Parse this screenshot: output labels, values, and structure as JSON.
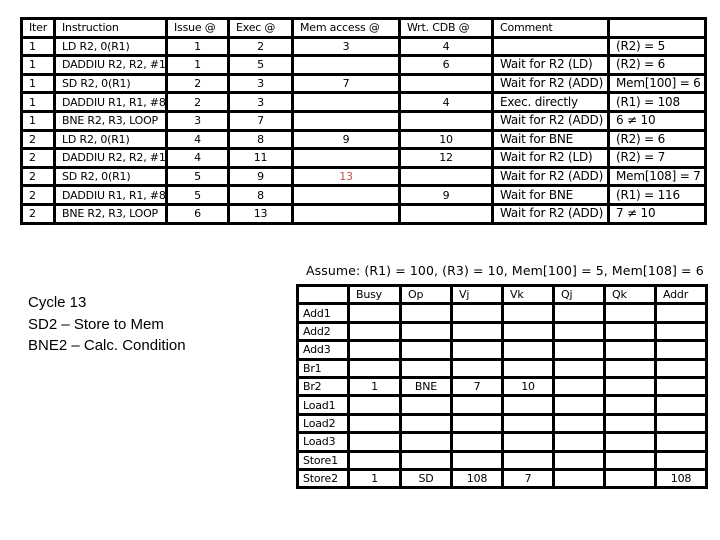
{
  "schedule": {
    "headers": [
      "Iter",
      "Instruction",
      "Issue @",
      "Exec @",
      "Mem access @",
      "Wrt. CDB @",
      "Comment",
      ""
    ],
    "rows": [
      {
        "iter": "1",
        "instruction": "LD R2, 0(R1)",
        "issue": "1",
        "exec": "2",
        "mem": "3",
        "cdb": "4",
        "comment": "",
        "result": "(R2) = 5"
      },
      {
        "iter": "1",
        "instruction": "DADDIU R2, R2, #1",
        "issue": "1",
        "exec": "5",
        "mem": "",
        "cdb": "6",
        "comment": "Wait for R2 (LD)",
        "result": "(R2) = 6"
      },
      {
        "iter": "1",
        "instruction": "SD R2, 0(R1)",
        "issue": "2",
        "exec": "3",
        "mem": "7",
        "cdb": "",
        "comment": "Wait for R2 (ADD)",
        "result": "Mem[100] = 6"
      },
      {
        "iter": "1",
        "instruction": "DADDIU R1, R1, #8",
        "issue": "2",
        "exec": "3",
        "mem": "",
        "cdb": "4",
        "comment": "Exec. directly",
        "result": "(R1) = 108"
      },
      {
        "iter": "1",
        "instruction": "BNE R2, R3, LOOP",
        "issue": "3",
        "exec": "7",
        "mem": "",
        "cdb": "",
        "comment": "Wait for R2 (ADD)",
        "result": "6 ≠ 10"
      },
      {
        "iter": "2",
        "instruction": "LD R2, 0(R1)",
        "issue": "4",
        "exec": "8",
        "mem": "9",
        "cdb": "10",
        "comment": "Wait for BNE",
        "result": "(R2) = 6"
      },
      {
        "iter": "2",
        "instruction": "DADDIU R2, R2, #1",
        "issue": "4",
        "exec": "11",
        "mem": "",
        "cdb": "12",
        "comment": "Wait for R2 (LD)",
        "result": "(R2) = 7"
      },
      {
        "iter": "2",
        "instruction": "SD R2, 0(R1)",
        "issue": "5",
        "exec": "9",
        "mem": "13",
        "cdb": "",
        "comment": "Wait for R2 (ADD)",
        "result": "Mem[108] = 7"
      },
      {
        "iter": "2",
        "instruction": "DADDIU R1, R1, #8",
        "issue": "5",
        "exec": "8",
        "mem": "",
        "cdb": "9",
        "comment": "Wait for BNE",
        "result": "(R1) = 116"
      },
      {
        "iter": "2",
        "instruction": "BNE R2, R3, LOOP",
        "issue": "6",
        "exec": "13",
        "mem": "",
        "cdb": "",
        "comment": "Wait for R2 (ADD)",
        "result": "7 ≠ 10"
      }
    ],
    "highlight_color": "#c0504d"
  },
  "assumption": "Assume: (R1) = 100, (R3) = 10, Mem[100] = 5, Mem[108] = 6",
  "notes": [
    "Cycle 13",
    "SD2 – Store to Mem",
    "BNE2 – Calc. Condition"
  ],
  "reservation_stations": {
    "headers": [
      "",
      "Busy",
      "Op",
      "Vj",
      "Vk",
      "Qj",
      "Qk",
      "Addr"
    ],
    "rows": [
      {
        "name": "Add1",
        "busy": "",
        "op": "",
        "vj": "",
        "vk": "",
        "qj": "",
        "qk": "",
        "addr": ""
      },
      {
        "name": "Add2",
        "busy": "",
        "op": "",
        "vj": "",
        "vk": "",
        "qj": "",
        "qk": "",
        "addr": ""
      },
      {
        "name": "Add3",
        "busy": "",
        "op": "",
        "vj": "",
        "vk": "",
        "qj": "",
        "qk": "",
        "addr": ""
      },
      {
        "name": "Br1",
        "busy": "",
        "op": "",
        "vj": "",
        "vk": "",
        "qj": "",
        "qk": "",
        "addr": ""
      },
      {
        "name": "Br2",
        "busy": "1",
        "op": "BNE",
        "vj": "7",
        "vk": "10",
        "qj": "",
        "qk": "",
        "addr": ""
      },
      {
        "name": "Load1",
        "busy": "",
        "op": "",
        "vj": "",
        "vk": "",
        "qj": "",
        "qk": "",
        "addr": ""
      },
      {
        "name": "Load2",
        "busy": "",
        "op": "",
        "vj": "",
        "vk": "",
        "qj": "",
        "qk": "",
        "addr": ""
      },
      {
        "name": "Load3",
        "busy": "",
        "op": "",
        "vj": "",
        "vk": "",
        "qj": "",
        "qk": "",
        "addr": ""
      },
      {
        "name": "Store1",
        "busy": "",
        "op": "",
        "vj": "",
        "vk": "",
        "qj": "",
        "qk": "",
        "addr": ""
      },
      {
        "name": "Store2",
        "busy": "1",
        "op": "SD",
        "vj": "108",
        "vk": "7",
        "qj": "",
        "qk": "",
        "addr": "108"
      }
    ]
  }
}
